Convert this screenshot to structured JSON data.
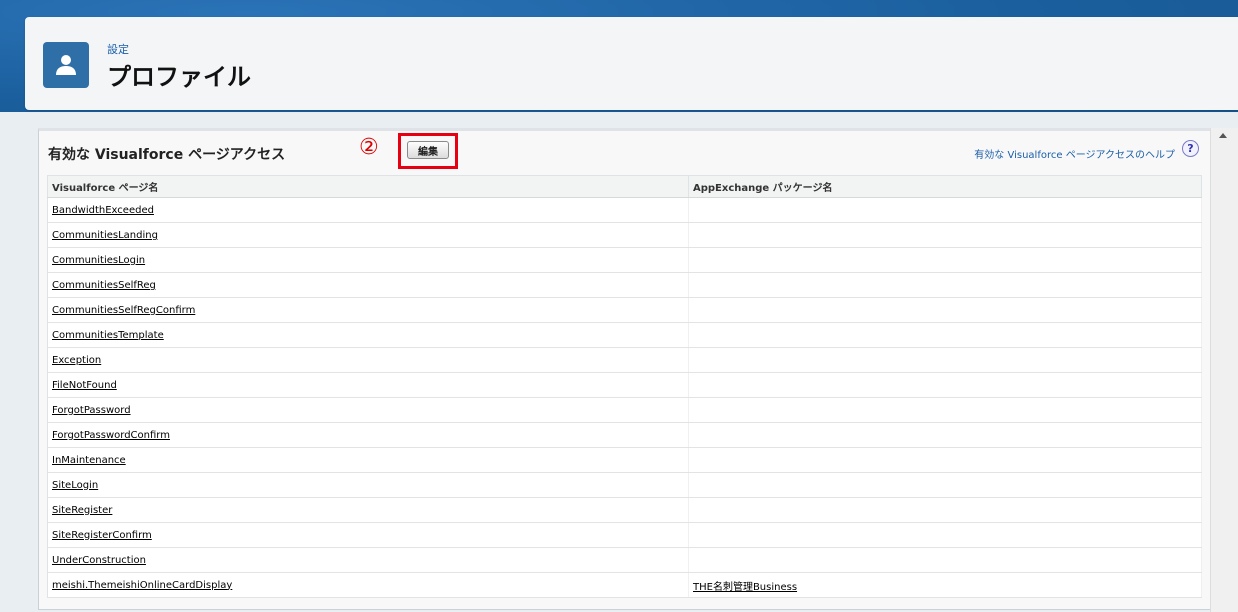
{
  "header": {
    "breadcrumb": "設定",
    "title": "プロファイル",
    "icon": "user-icon"
  },
  "panel": {
    "title": "有効な Visualforce ページアクセス",
    "step_marker": "②",
    "edit_label": "編集",
    "help_link": "有効な Visualforce ページアクセスのヘルプ",
    "help_icon_text": "?",
    "highlight_color": "#e60012"
  },
  "table": {
    "columns": [
      "Visualforce ページ名",
      "AppExchange パッケージ名"
    ],
    "rows": [
      {
        "name": "BandwidthExceeded",
        "package": ""
      },
      {
        "name": "CommunitiesLanding",
        "package": ""
      },
      {
        "name": "CommunitiesLogin",
        "package": ""
      },
      {
        "name": "CommunitiesSelfReg",
        "package": ""
      },
      {
        "name": "CommunitiesSelfRegConfirm",
        "package": ""
      },
      {
        "name": "CommunitiesTemplate",
        "package": ""
      },
      {
        "name": "Exception",
        "package": ""
      },
      {
        "name": "FileNotFound",
        "package": ""
      },
      {
        "name": "ForgotPassword",
        "package": ""
      },
      {
        "name": "ForgotPasswordConfirm",
        "package": ""
      },
      {
        "name": "InMaintenance",
        "package": ""
      },
      {
        "name": "SiteLogin",
        "package": ""
      },
      {
        "name": "SiteRegister",
        "package": ""
      },
      {
        "name": "SiteRegisterConfirm",
        "package": ""
      },
      {
        "name": "UnderConstruction",
        "package": ""
      },
      {
        "name": "meishi.ThemeishiOnlineCardDisplay",
        "package": "THE名刺管理Business"
      }
    ]
  }
}
